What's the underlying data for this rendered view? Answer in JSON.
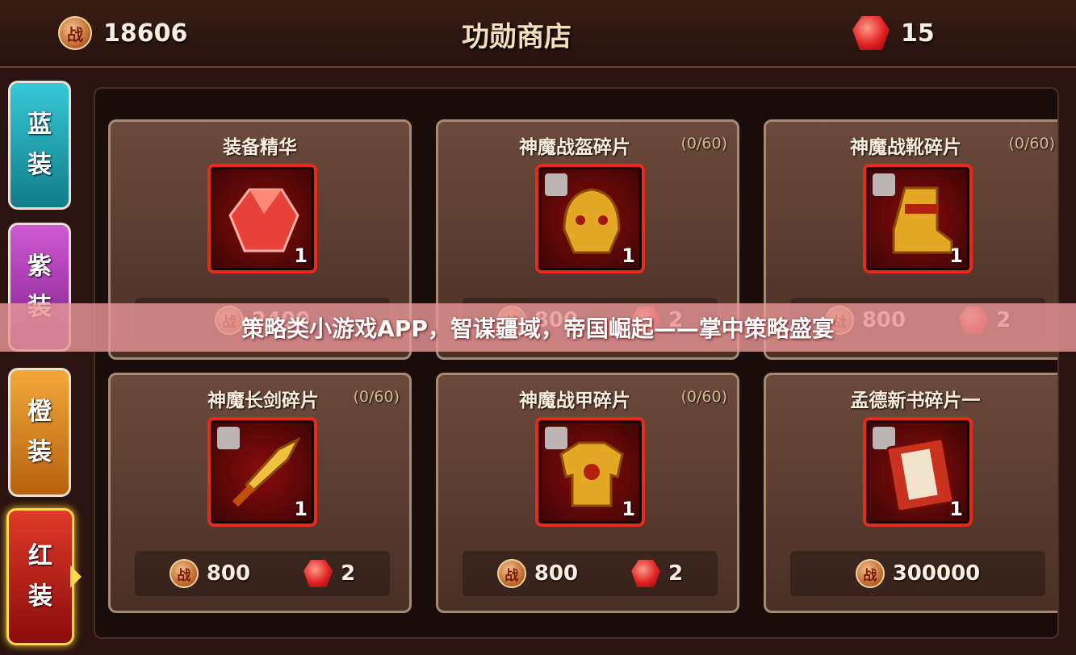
{
  "header": {
    "merit_icon": "战",
    "merit_value": "18606",
    "title": "功勋商店",
    "gem_value": "15"
  },
  "tabs": [
    {
      "label_top": "蓝",
      "label_bottom": "装"
    },
    {
      "label_top": "紫",
      "label_bottom": "装"
    },
    {
      "label_top": "橙",
      "label_bottom": "装"
    },
    {
      "label_top": "红",
      "label_bottom": "装"
    }
  ],
  "items": [
    {
      "name": "装备精华",
      "count": "",
      "qty": "1",
      "price_merit": "2400",
      "price_gem": ""
    },
    {
      "name": "神魔战盔碎片",
      "count": "(0/60)",
      "qty": "1",
      "price_merit": "800",
      "price_gem": "2"
    },
    {
      "name": "神魔战靴碎片",
      "count": "(0/60)",
      "qty": "1",
      "price_merit": "800",
      "price_gem": "2"
    },
    {
      "name": "神魔长剑碎片",
      "count": "(0/60)",
      "qty": "1",
      "price_merit": "800",
      "price_gem": "2"
    },
    {
      "name": "神魔战甲碎片",
      "count": "(0/60)",
      "qty": "1",
      "price_merit": "800",
      "price_gem": "2"
    },
    {
      "name": "孟德新书碎片一",
      "count": "",
      "qty": "1",
      "price_merit": "300000",
      "price_gem": ""
    }
  ],
  "banner": "策略类小游戏APP，智谋疆域，帝国崛起——掌中策略盛宴",
  "colors": {
    "tab_blue": "#35c8d6",
    "tab_purple": "#d05ad4",
    "tab_orange": "#f2a73a",
    "tab_red": "#e03a2a",
    "item_border": "#e82a1a"
  }
}
